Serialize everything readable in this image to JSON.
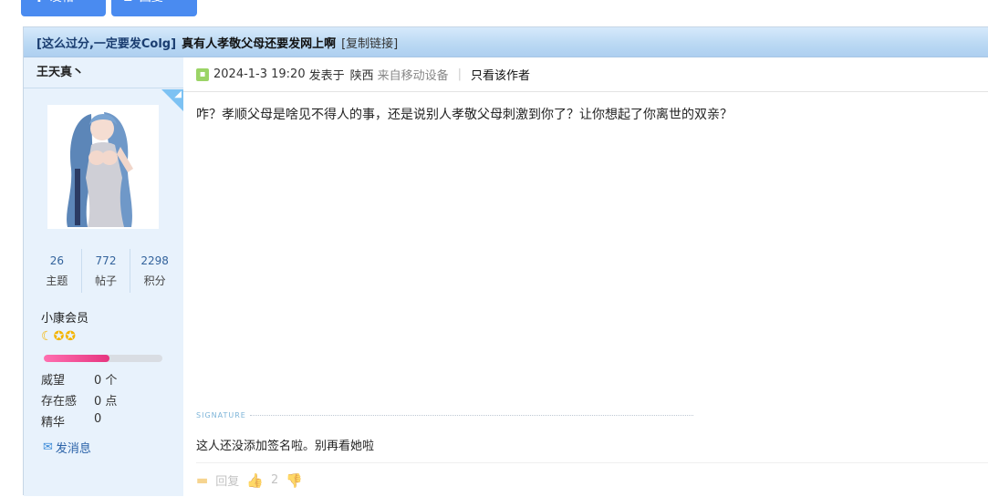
{
  "toolbar": {
    "post_label": "发帖",
    "post_icon": "plus-icon",
    "reply_label": "回复",
    "reply_icon": "reply-icon",
    "button_color": "#4a8bf0"
  },
  "thread": {
    "tag": "[这么过分,一定要发Colg]",
    "subject": "真有人孝敬父母还要发网上啊",
    "copy_link": "[复制链接]"
  },
  "author": {
    "name": "王天真丶",
    "stats": [
      {
        "value": "26",
        "label": "主题"
      },
      {
        "value": "772",
        "label": "帖子"
      },
      {
        "value": "2298",
        "label": "积分"
      }
    ],
    "group": "小康会员",
    "level_icons": [
      "moon-icon",
      "star-icon",
      "star-icon"
    ],
    "level_progress": 0.55,
    "props": [
      {
        "label": "威望",
        "value": "0 个"
      },
      {
        "label": "存在感",
        "value": "0 点"
      },
      {
        "label": "精华",
        "value": "0"
      }
    ],
    "send_message": "发消息"
  },
  "post": {
    "datetime": "2024-1-3 19:20",
    "posted_at": "发表于",
    "location": "陕西",
    "device": "来自移动设备",
    "author_only": "只看该作者",
    "message": "咋？孝顺父母是啥见不得人的事，还是说别人孝敬父母刺激到你了？让你想起了你离世的双亲？",
    "signature_header": "SIGNATURE",
    "signature": "这人还没添加签名啦。别再看她啦",
    "actions": {
      "reply_label": "回复",
      "like_count": "2"
    }
  }
}
